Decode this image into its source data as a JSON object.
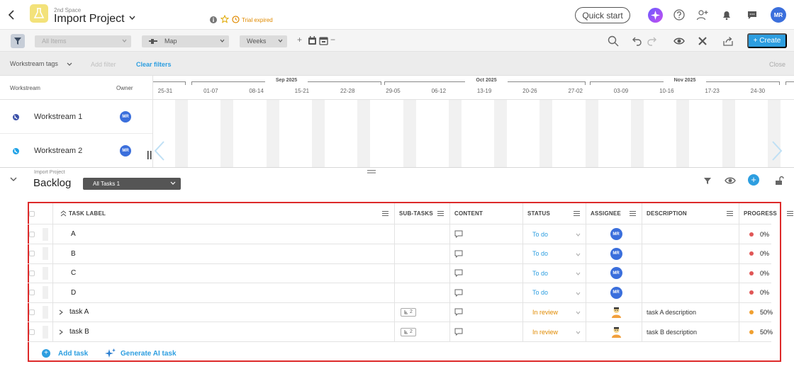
{
  "header": {
    "space_name": "2nd Space",
    "project_title": "Import Project",
    "trial_text": "Trial expired",
    "quick_start_label": "Quick start",
    "user_initials": "MR"
  },
  "toolbar": {
    "items_placeholder": "All Items",
    "view_label": "Map",
    "scale_label": "Weeks",
    "zoom_in": "+",
    "zoom_out": "−",
    "create_label": "+ Create"
  },
  "filterbar": {
    "workstream_tags": "Workstream tags",
    "add_filter": "Add filter",
    "clear_filters": "Clear filters",
    "close": "Close"
  },
  "timeline": {
    "col_workstream": "Workstream",
    "col_owner": "Owner",
    "months": [
      "Sep 2025",
      "Oct 2025",
      "Nov 2025"
    ],
    "weeks": [
      "25-31",
      "01-07",
      "08-14",
      "15-21",
      "22-28",
      "29-05",
      "06-12",
      "13-19",
      "20-26",
      "27-02",
      "03-09",
      "10-16",
      "17-23",
      "24-30"
    ],
    "workstreams": [
      {
        "name": "Workstream 1",
        "owner": "MR",
        "color": "#3b50a8"
      },
      {
        "name": "Workstream 2",
        "owner": "MR",
        "color": "#1da1e6"
      }
    ]
  },
  "backlog": {
    "crumb": "Import Project",
    "title": "Backlog",
    "filter_label": "All Tasks 1",
    "columns": {
      "label": "TASK LABEL",
      "subtasks": "SUB-TASKS",
      "content": "CONTENT",
      "status": "STATUS",
      "assignee": "ASSIGNEE",
      "description": "DESCRIPTION",
      "progress": "PROGRESS"
    },
    "tasks": [
      {
        "label": "A",
        "subtasks": "",
        "status": "To do",
        "assignee": "MR",
        "description": "",
        "progress": "0%"
      },
      {
        "label": "B",
        "subtasks": "",
        "status": "To do",
        "assignee": "MR",
        "description": "",
        "progress": "0%"
      },
      {
        "label": "C",
        "subtasks": "",
        "status": "To do",
        "assignee": "MR",
        "description": "",
        "progress": "0%"
      },
      {
        "label": "D",
        "subtasks": "",
        "status": "To do",
        "assignee": "MR",
        "description": "",
        "progress": "0%"
      },
      {
        "label": "task A",
        "subtasks": "2",
        "status": "In review",
        "assignee": "",
        "description": "task A description",
        "progress": "50%"
      },
      {
        "label": "task B",
        "subtasks": "2",
        "status": "In review",
        "assignee": "",
        "description": "task B description",
        "progress": "50%"
      }
    ],
    "add_task": "Add task",
    "generate_ai_task": "Generate AI task"
  },
  "colors": {
    "accent": "#2d9ee0",
    "todo": "#2d9ee0",
    "in_review": "#e08a00",
    "progress_zero": "#e05656",
    "progress_half": "#f0a030",
    "highlight_frame": "#dd2a2a"
  }
}
